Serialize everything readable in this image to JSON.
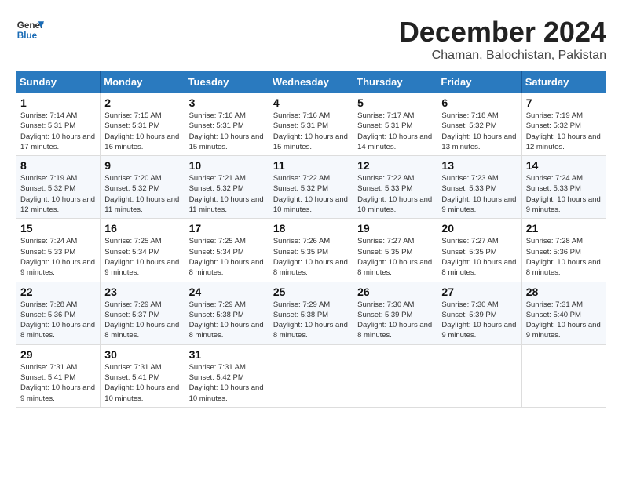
{
  "logo": {
    "line1": "General",
    "line2": "Blue"
  },
  "title": "December 2024",
  "location": "Chaman, Balochistan, Pakistan",
  "days_of_week": [
    "Sunday",
    "Monday",
    "Tuesday",
    "Wednesday",
    "Thursday",
    "Friday",
    "Saturday"
  ],
  "weeks": [
    [
      {
        "day": "1",
        "sunrise": "Sunrise: 7:14 AM",
        "sunset": "Sunset: 5:31 PM",
        "daylight": "Daylight: 10 hours and 17 minutes."
      },
      {
        "day": "2",
        "sunrise": "Sunrise: 7:15 AM",
        "sunset": "Sunset: 5:31 PM",
        "daylight": "Daylight: 10 hours and 16 minutes."
      },
      {
        "day": "3",
        "sunrise": "Sunrise: 7:16 AM",
        "sunset": "Sunset: 5:31 PM",
        "daylight": "Daylight: 10 hours and 15 minutes."
      },
      {
        "day": "4",
        "sunrise": "Sunrise: 7:16 AM",
        "sunset": "Sunset: 5:31 PM",
        "daylight": "Daylight: 10 hours and 15 minutes."
      },
      {
        "day": "5",
        "sunrise": "Sunrise: 7:17 AM",
        "sunset": "Sunset: 5:31 PM",
        "daylight": "Daylight: 10 hours and 14 minutes."
      },
      {
        "day": "6",
        "sunrise": "Sunrise: 7:18 AM",
        "sunset": "Sunset: 5:32 PM",
        "daylight": "Daylight: 10 hours and 13 minutes."
      },
      {
        "day": "7",
        "sunrise": "Sunrise: 7:19 AM",
        "sunset": "Sunset: 5:32 PM",
        "daylight": "Daylight: 10 hours and 12 minutes."
      }
    ],
    [
      {
        "day": "8",
        "sunrise": "Sunrise: 7:19 AM",
        "sunset": "Sunset: 5:32 PM",
        "daylight": "Daylight: 10 hours and 12 minutes."
      },
      {
        "day": "9",
        "sunrise": "Sunrise: 7:20 AM",
        "sunset": "Sunset: 5:32 PM",
        "daylight": "Daylight: 10 hours and 11 minutes."
      },
      {
        "day": "10",
        "sunrise": "Sunrise: 7:21 AM",
        "sunset": "Sunset: 5:32 PM",
        "daylight": "Daylight: 10 hours and 11 minutes."
      },
      {
        "day": "11",
        "sunrise": "Sunrise: 7:22 AM",
        "sunset": "Sunset: 5:32 PM",
        "daylight": "Daylight: 10 hours and 10 minutes."
      },
      {
        "day": "12",
        "sunrise": "Sunrise: 7:22 AM",
        "sunset": "Sunset: 5:33 PM",
        "daylight": "Daylight: 10 hours and 10 minutes."
      },
      {
        "day": "13",
        "sunrise": "Sunrise: 7:23 AM",
        "sunset": "Sunset: 5:33 PM",
        "daylight": "Daylight: 10 hours and 9 minutes."
      },
      {
        "day": "14",
        "sunrise": "Sunrise: 7:24 AM",
        "sunset": "Sunset: 5:33 PM",
        "daylight": "Daylight: 10 hours and 9 minutes."
      }
    ],
    [
      {
        "day": "15",
        "sunrise": "Sunrise: 7:24 AM",
        "sunset": "Sunset: 5:33 PM",
        "daylight": "Daylight: 10 hours and 9 minutes."
      },
      {
        "day": "16",
        "sunrise": "Sunrise: 7:25 AM",
        "sunset": "Sunset: 5:34 PM",
        "daylight": "Daylight: 10 hours and 9 minutes."
      },
      {
        "day": "17",
        "sunrise": "Sunrise: 7:25 AM",
        "sunset": "Sunset: 5:34 PM",
        "daylight": "Daylight: 10 hours and 8 minutes."
      },
      {
        "day": "18",
        "sunrise": "Sunrise: 7:26 AM",
        "sunset": "Sunset: 5:35 PM",
        "daylight": "Daylight: 10 hours and 8 minutes."
      },
      {
        "day": "19",
        "sunrise": "Sunrise: 7:27 AM",
        "sunset": "Sunset: 5:35 PM",
        "daylight": "Daylight: 10 hours and 8 minutes."
      },
      {
        "day": "20",
        "sunrise": "Sunrise: 7:27 AM",
        "sunset": "Sunset: 5:35 PM",
        "daylight": "Daylight: 10 hours and 8 minutes."
      },
      {
        "day": "21",
        "sunrise": "Sunrise: 7:28 AM",
        "sunset": "Sunset: 5:36 PM",
        "daylight": "Daylight: 10 hours and 8 minutes."
      }
    ],
    [
      {
        "day": "22",
        "sunrise": "Sunrise: 7:28 AM",
        "sunset": "Sunset: 5:36 PM",
        "daylight": "Daylight: 10 hours and 8 minutes."
      },
      {
        "day": "23",
        "sunrise": "Sunrise: 7:29 AM",
        "sunset": "Sunset: 5:37 PM",
        "daylight": "Daylight: 10 hours and 8 minutes."
      },
      {
        "day": "24",
        "sunrise": "Sunrise: 7:29 AM",
        "sunset": "Sunset: 5:38 PM",
        "daylight": "Daylight: 10 hours and 8 minutes."
      },
      {
        "day": "25",
        "sunrise": "Sunrise: 7:29 AM",
        "sunset": "Sunset: 5:38 PM",
        "daylight": "Daylight: 10 hours and 8 minutes."
      },
      {
        "day": "26",
        "sunrise": "Sunrise: 7:30 AM",
        "sunset": "Sunset: 5:39 PM",
        "daylight": "Daylight: 10 hours and 8 minutes."
      },
      {
        "day": "27",
        "sunrise": "Sunrise: 7:30 AM",
        "sunset": "Sunset: 5:39 PM",
        "daylight": "Daylight: 10 hours and 9 minutes."
      },
      {
        "day": "28",
        "sunrise": "Sunrise: 7:31 AM",
        "sunset": "Sunset: 5:40 PM",
        "daylight": "Daylight: 10 hours and 9 minutes."
      }
    ],
    [
      {
        "day": "29",
        "sunrise": "Sunrise: 7:31 AM",
        "sunset": "Sunset: 5:41 PM",
        "daylight": "Daylight: 10 hours and 9 minutes."
      },
      {
        "day": "30",
        "sunrise": "Sunrise: 7:31 AM",
        "sunset": "Sunset: 5:41 PM",
        "daylight": "Daylight: 10 hours and 10 minutes."
      },
      {
        "day": "31",
        "sunrise": "Sunrise: 7:31 AM",
        "sunset": "Sunset: 5:42 PM",
        "daylight": "Daylight: 10 hours and 10 minutes."
      },
      null,
      null,
      null,
      null
    ]
  ]
}
